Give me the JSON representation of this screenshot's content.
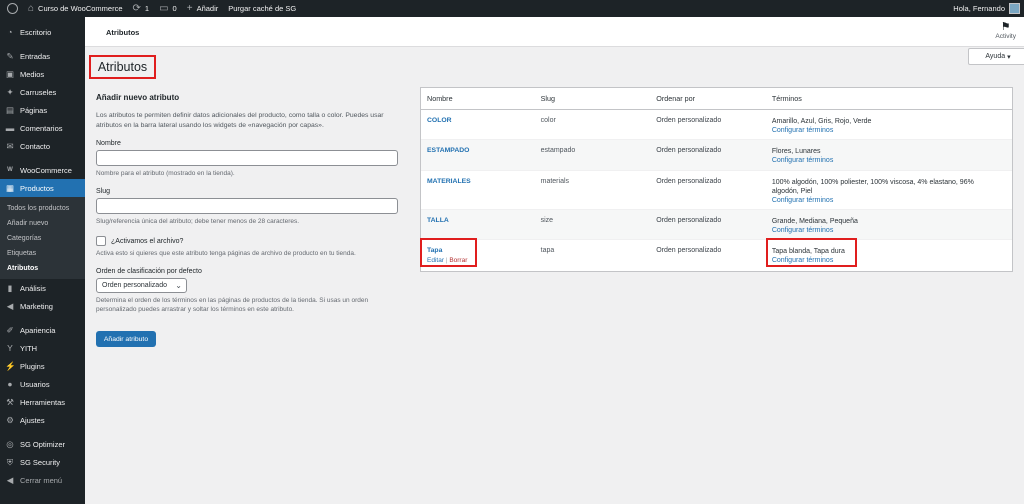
{
  "adminbar": {
    "site_name": "Curso de WooCommerce",
    "updates_count": "1",
    "comments_count": "0",
    "new_label": "Añadir",
    "purge_label": "Purgar caché de SG",
    "greeting": "Hola, Fernando"
  },
  "sidebar": {
    "items": [
      {
        "label": "Escritorio",
        "icon": "dashboard-icon"
      },
      {
        "label": "Entradas",
        "icon": "pin-icon"
      },
      {
        "label": "Medios",
        "icon": "media-icon"
      },
      {
        "label": "Carruseles",
        "icon": "carousel-icon"
      },
      {
        "label": "Páginas",
        "icon": "pages-icon"
      },
      {
        "label": "Comentarios",
        "icon": "comments-icon"
      },
      {
        "label": "Contacto",
        "icon": "mail-icon"
      },
      {
        "label": "WooCommerce",
        "icon": "woo-icon"
      },
      {
        "label": "Productos",
        "icon": "products-icon"
      },
      {
        "label": "Análisis",
        "icon": "chart-icon"
      },
      {
        "label": "Marketing",
        "icon": "megaphone-icon"
      },
      {
        "label": "Apariencia",
        "icon": "brush-icon"
      },
      {
        "label": "YITH",
        "icon": "yith-icon"
      },
      {
        "label": "Plugins",
        "icon": "plugin-icon"
      },
      {
        "label": "Usuarios",
        "icon": "users-icon"
      },
      {
        "label": "Herramientas",
        "icon": "wrench-icon"
      },
      {
        "label": "Ajustes",
        "icon": "settings-icon"
      },
      {
        "label": "SG Optimizer",
        "icon": "sg-optimizer-icon"
      },
      {
        "label": "SG Security",
        "icon": "shield-icon"
      },
      {
        "label": "Cerrar menú",
        "icon": "collapse-icon"
      }
    ],
    "submenu": [
      "Todos los productos",
      "Añadir nuevo",
      "Categorías",
      "Etiquetas",
      "Atributos"
    ]
  },
  "header": {
    "breadcrumb": "Atributos",
    "activity_label": "Activity",
    "help_label": "Ayuda"
  },
  "page_title": "Atributos",
  "form": {
    "heading": "Añadir nuevo atributo",
    "intro": "Los atributos te permiten definir datos adicionales del producto, como talla o color. Puedes usar atributos en la barra lateral usando los widgets de «navegación por capas».",
    "name_label": "Nombre",
    "name_value": "",
    "name_desc": "Nombre para el atributo (mostrado en la tienda).",
    "slug_label": "Slug",
    "slug_value": "",
    "slug_desc": "Slug/referencia única del atributo; debe tener menos de 28 caracteres.",
    "archive_label": "¿Activamos el archivo?",
    "archive_desc": "Activa esto si quieres que este atributo tenga páginas de archivo de producto en tu tienda.",
    "order_label": "Orden de clasificación por defecto",
    "order_value": "Orden personalizado",
    "order_desc": "Determina el orden de los términos en las páginas de productos de la tienda. Si usas un orden personalizado puedes arrastrar y soltar los términos en este atributo.",
    "submit_label": "Añadir atributo"
  },
  "table": {
    "headers": [
      "Nombre",
      "Slug",
      "Ordenar por",
      "Términos"
    ],
    "rows": [
      {
        "name": "COLOR",
        "slug": "color",
        "order": "Orden personalizado",
        "terms": "Amarillo, Azul, Gris, Rojo, Verde",
        "configure": "Configurar términos"
      },
      {
        "name": "ESTAMPADO",
        "slug": "estampado",
        "order": "Orden personalizado",
        "terms": "Flores, Lunares",
        "configure": "Configurar términos"
      },
      {
        "name": "MATERIALES",
        "slug": "materials",
        "order": "Orden personalizado",
        "terms": "100% algodón, 100% poliester, 100% viscosa, 4% elastano, 96% algodón, Piel",
        "configure": "Configurar términos"
      },
      {
        "name": "TALLA",
        "slug": "size",
        "order": "Orden personalizado",
        "terms": "Grande, Mediana, Pequeña",
        "configure": "Configurar términos"
      },
      {
        "name": "Tapa",
        "slug": "tapa",
        "order": "Orden personalizado",
        "terms": "Tapa blanda, Tapa dura",
        "configure": "Configurar términos",
        "edit": "Editar",
        "sep": "|",
        "delete": "Borrar"
      }
    ]
  },
  "colors": {
    "accent": "#2271b1",
    "highlight": "#e01e1e",
    "sidebar_bg": "#1d2327"
  }
}
